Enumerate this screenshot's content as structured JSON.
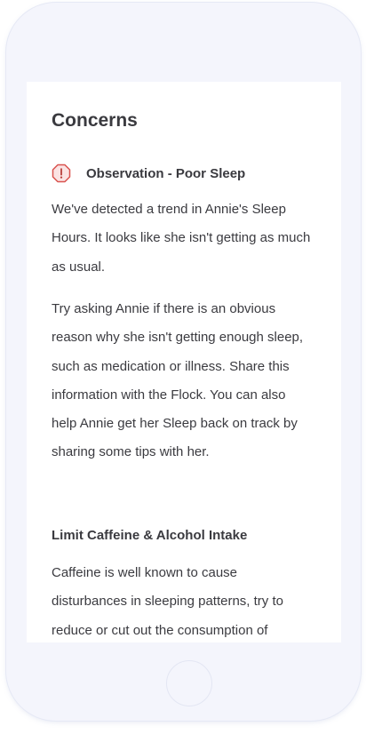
{
  "concerns": {
    "title": "Concerns",
    "observation": {
      "icon": "alert-octagon-icon",
      "icon_color": "#d9534f",
      "icon_fill": "#fbe3e3",
      "title": "Observation - Poor Sleep"
    },
    "paragraph_1": "We've detected a trend in Annie's Sleep Hours. It looks like she isn't getting as much as usual.",
    "paragraph_2": "Try asking Annie if there is an obvious reason why she isn't getting enough sleep, such as medication or illness. Share this information with the Flock. You can also help Annie get her Sleep back on track by sharing some tips with her.",
    "tip": {
      "heading": "Limit Caffeine & Alcohol Intake",
      "body": "Caffeine is well known to cause disturbances in sleeping patterns, try to reduce or cut out the consumption of"
    }
  }
}
